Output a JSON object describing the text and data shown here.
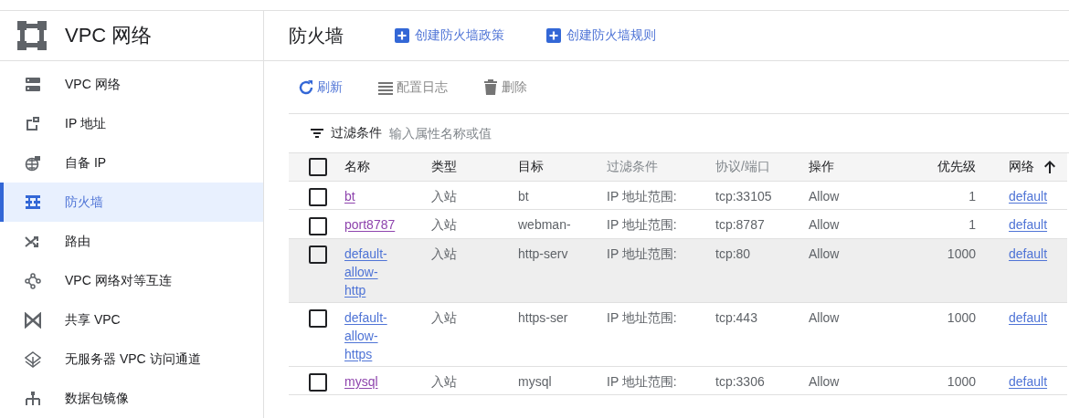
{
  "product": {
    "title": "VPC 网络"
  },
  "sidebar": {
    "items": [
      {
        "label": "VPC 网络",
        "selected": false
      },
      {
        "label": "IP 地址",
        "selected": false
      },
      {
        "label": "自备 IP",
        "selected": false
      },
      {
        "label": "防火墙",
        "selected": true
      },
      {
        "label": "路由",
        "selected": false
      },
      {
        "label": "VPC 网络对等互连",
        "selected": false
      },
      {
        "label": "共享 VPC",
        "selected": false
      },
      {
        "label": "无服务器 VPC 访问通道",
        "selected": false
      },
      {
        "label": "数据包镜像",
        "selected": false
      }
    ]
  },
  "page": {
    "title": "防火墙",
    "actions": [
      "创建防火墙政策",
      "创建防火墙规则"
    ]
  },
  "toolbar": [
    {
      "label": "刷新",
      "kind": "refresh",
      "disabled": false
    },
    {
      "label": "配置日志",
      "kind": "logs",
      "disabled": true
    },
    {
      "label": "删除",
      "kind": "delete",
      "disabled": true
    }
  ],
  "filter": {
    "label": "过滤条件",
    "placeholder": "输入属性名称或值"
  },
  "table": {
    "select_all": {
      "checked": false
    },
    "columns": [
      {
        "label": "名称",
        "muted": false
      },
      {
        "label": "类型",
        "muted": false
      },
      {
        "label": "目标",
        "muted": false
      },
      {
        "label": "过滤条件",
        "muted": true
      },
      {
        "label": "协议/端口",
        "muted": true
      },
      {
        "label": "操作",
        "muted": false
      },
      {
        "label": "优先级",
        "muted": false
      },
      {
        "label": "网络",
        "muted": false,
        "sorted": true,
        "ascending": true
      }
    ],
    "rows": [
      {
        "checked": false,
        "hovered": false,
        "name": "bt",
        "visited": true,
        "type": "入站",
        "target": "bt",
        "filter": "IP 地址范围:",
        "protocol": "tcp:33105",
        "action": "Allow",
        "priority": "1",
        "network": "default"
      },
      {
        "checked": false,
        "hovered": false,
        "name": "port8787",
        "visited": true,
        "type": "入站",
        "target": "webman-",
        "filter": "IP 地址范围:",
        "protocol": "tcp:8787",
        "action": "Allow",
        "priority": "1",
        "network": "default"
      },
      {
        "checked": false,
        "hovered": true,
        "name": "default-allow-http",
        "visited": false,
        "type": "入站",
        "target": "http-serv",
        "filter": "IP 地址范围:",
        "protocol": "tcp:80",
        "action": "Allow",
        "priority": "1000",
        "network": "default"
      },
      {
        "checked": false,
        "hovered": false,
        "name": "default-allow-https",
        "visited": false,
        "type": "入站",
        "target": "https-ser",
        "filter": "IP 地址范围:",
        "protocol": "tcp:443",
        "action": "Allow",
        "priority": "1000",
        "network": "default"
      },
      {
        "checked": false,
        "hovered": false,
        "name": "mysql",
        "visited": true,
        "type": "入站",
        "target": "mysql",
        "filter": "IP 地址范围:",
        "protocol": "tcp:3306",
        "action": "Allow",
        "priority": "1000",
        "network": "default"
      }
    ]
  }
}
